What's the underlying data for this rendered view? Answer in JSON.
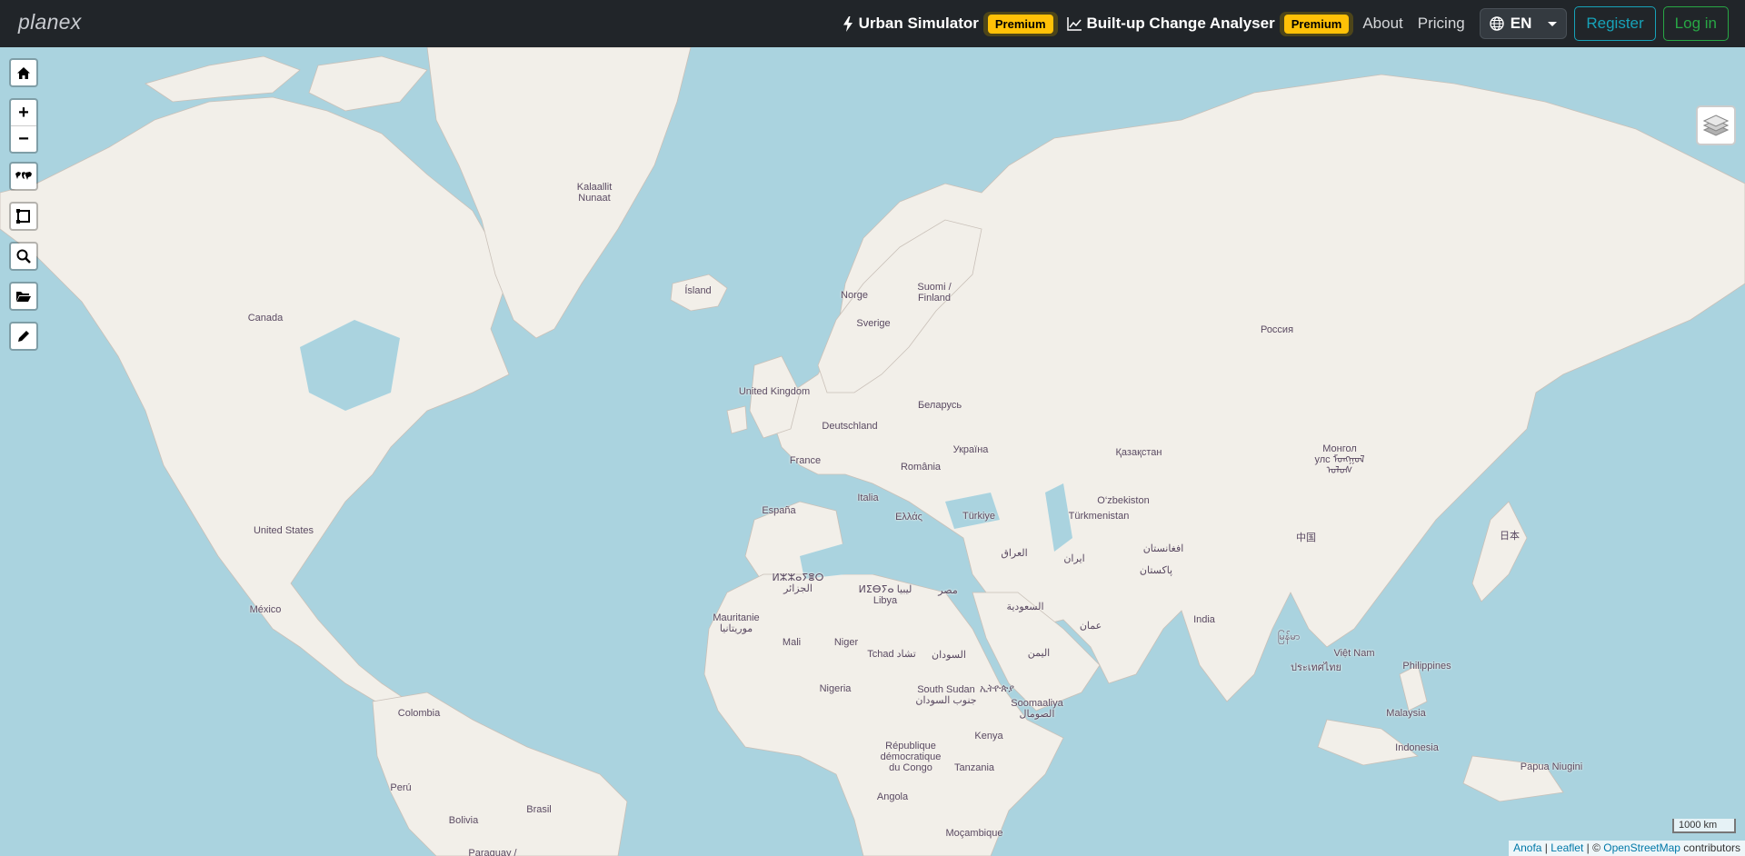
{
  "brand": "planex",
  "nav": {
    "urban_simulator": "Urban Simulator",
    "urban_badge": "Premium",
    "change_analyser": "Built-up Change Analyser",
    "change_badge": "Premium",
    "about": "About",
    "pricing": "Pricing",
    "language": "EN",
    "register": "Register",
    "login": "Log in"
  },
  "icons": {
    "urban_simulator": "lightning-icon",
    "change_analyser": "line-chart-icon",
    "language": "globe-icon",
    "home": "home-icon",
    "zoom_in": "plus-icon",
    "zoom_out": "minus-icon",
    "world": "world-map-icon",
    "draw_rectangle": "rectangle-icon",
    "search": "search-icon",
    "open": "folder-icon",
    "edit": "pencil-icon",
    "layers": "layers-icon"
  },
  "map": {
    "zoom_in": "+",
    "zoom_out": "−",
    "scale": "1000 km",
    "attribution": {
      "anofa": "Anofa",
      "sep1": " | ",
      "leaflet": "Leaflet",
      "sep2": " | © ",
      "osm": "OpenStreetMap",
      "suffix": " contributors"
    },
    "labels": {
      "greenland": "Kalaallit\nNunaat",
      "iceland": "Ísland",
      "canada": "Canada",
      "norway": "Norge",
      "finland": "Suomi /\nFinland",
      "sweden": "Sverige",
      "russia": "Россия",
      "uk": "United Kingdom",
      "belarus": "Беларусь",
      "germany": "Deutschland",
      "ukraine": "Україна",
      "kazakhstan": "Қазақстан",
      "mongolia": "Монгол\nулс ᠮᠣᠩᠭᠣᠯ\nᠤᠯᠤᠰ",
      "france": "France",
      "romania": "România",
      "italy": "Italia",
      "uzbekistan": "O‘zbekiston",
      "usa": "United States",
      "spain": "España",
      "greece": "Ελλάς",
      "turkey": "Türkiye",
      "turkmenistan": "Türkmenistan",
      "china": "中国",
      "japan": "日本",
      "iraq": "العراق",
      "afghanistan": "افغانستان",
      "iran": "ایران",
      "pakistan": "پاکستان",
      "algeria": "ⵍⵣⵣⴰⵢⴻⵔ\nالجزائر",
      "libya": "ⵍⵉⴱⵢⴰ ليبيا\nLibya",
      "egypt": "مصر",
      "saudi": "السعودية",
      "mexico": "México",
      "mauritania": "Mauritanie\nموريتانيا",
      "oman": "عمان",
      "india": "India",
      "myanmar": "မြန်မာ",
      "mali": "Mali",
      "niger": "Niger",
      "chad": "Tchad تشاد",
      "sudan": "السودان",
      "yemen": "اليمن",
      "vietnam": "Việt Nam",
      "thailand": "ประเทศไทย",
      "philippines": "Philippines",
      "nigeria": "Nigeria",
      "south_sudan": "South Sudan\nجنوب السودان",
      "ethiopia": "ኢትዮጵያ",
      "somalia": "Soomaaliya\nالصومال",
      "colombia": "Colombia",
      "malaysia": "Malaysia",
      "kenya": "Kenya",
      "drc": "République\ndémocratique\ndu Congo",
      "indonesia": "Indonesia",
      "papua": "Papua Niugini",
      "tanzania": "Tanzania",
      "peru": "Perú",
      "brasil": "Brasil",
      "angola": "Angola",
      "bolivia": "Bolivia",
      "mozambique": "Moçambique",
      "paraguay": "Paraguay /"
    }
  }
}
